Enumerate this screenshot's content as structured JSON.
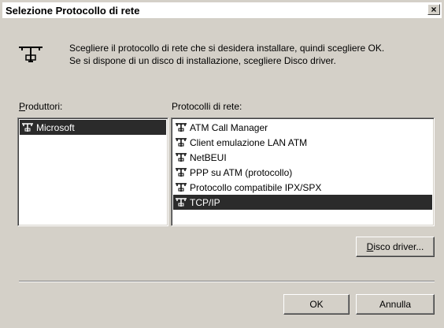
{
  "window": {
    "title": "Selezione Protocollo di rete",
    "close_glyph": "×"
  },
  "intro": {
    "line1": "Scegliere il protocollo di rete che si desidera installare, quindi scegliere OK.",
    "line2": "Se si dispone di un disco di installazione, scegliere Disco driver."
  },
  "manufacturers": {
    "label_accel": "P",
    "label_rest": "roduttori:",
    "items": [
      {
        "label": "Microsoft",
        "selected": true,
        "icon": "network-protocol-icon"
      }
    ]
  },
  "protocols": {
    "label": "Protocolli di rete:",
    "items": [
      {
        "label": "ATM Call Manager",
        "selected": false,
        "icon": "network-protocol-icon"
      },
      {
        "label": "Client emulazione LAN ATM",
        "selected": false,
        "icon": "network-protocol-icon"
      },
      {
        "label": "NetBEUI",
        "selected": false,
        "icon": "network-protocol-icon"
      },
      {
        "label": "PPP su ATM (protocollo)",
        "selected": false,
        "icon": "network-protocol-icon"
      },
      {
        "label": "Protocollo compatibile IPX/SPX",
        "selected": false,
        "icon": "network-protocol-icon"
      },
      {
        "label": "TCP/IP",
        "selected": true,
        "icon": "network-protocol-icon"
      }
    ]
  },
  "buttons": {
    "disk_accel": "D",
    "disk_rest": "isco driver...",
    "ok": "OK",
    "cancel": "Annulla"
  },
  "colors": {
    "dialog_face": "#d4d0c8",
    "selection": "#2b2b2b",
    "list_background": "#ffffff"
  }
}
